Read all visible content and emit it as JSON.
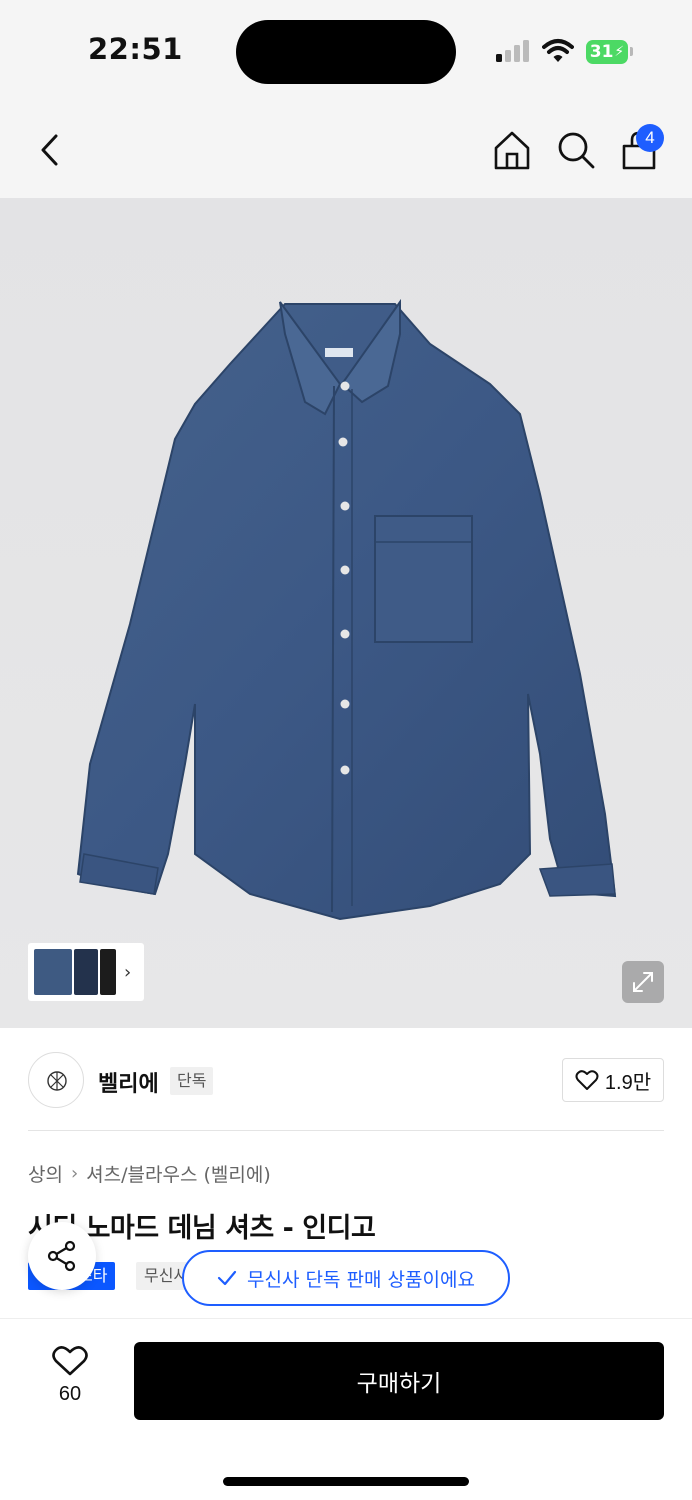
{
  "status_bar": {
    "time": "22:51",
    "battery": "31"
  },
  "nav": {
    "cart_badge": "4",
    "icons": [
      "back-icon",
      "home-icon",
      "search-icon",
      "cart-icon"
    ]
  },
  "gallery": {
    "thumbnail_colors": [
      "#3e5a82",
      "#23324c",
      "#1c1c1c"
    ]
  },
  "brand": {
    "name": "벨리에",
    "tag": "단독",
    "likes": "1.9만"
  },
  "breadcrumb": {
    "category": "상의",
    "subcategory": "셔츠/블라우스 (벨리에)"
  },
  "product": {
    "title": "시티 노마드 데님 셔츠 - 인디고",
    "tag_blue": "스타",
    "tag_gray": "무신사"
  },
  "toast": {
    "text": "무신사 단독 판매 상품이에요"
  },
  "bottom": {
    "wish_count": "60",
    "buy_label": "구매하기"
  },
  "colors": {
    "accent": "#1e5eff",
    "denim": "#3e5a82"
  }
}
